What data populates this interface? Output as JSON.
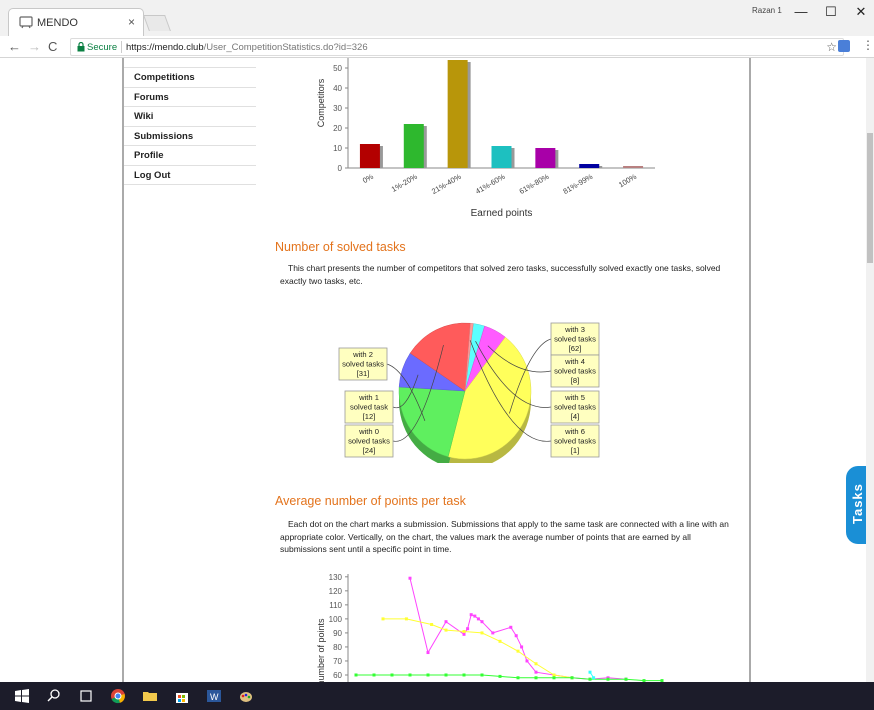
{
  "browser": {
    "tab_title": "MENDO",
    "tab_close": "×",
    "profile_name": "Razan 1",
    "minimize": "—",
    "maximize": "☐",
    "close": "✕",
    "secure_label": "Secure",
    "url_host": "https://mendo.club",
    "url_path": "/User_CompetitionStatistics.do?id=326"
  },
  "sidebar": {
    "items": [
      {
        "label": "Competitions"
      },
      {
        "label": "Forums"
      },
      {
        "label": "Wiki"
      },
      {
        "label": "Submissions"
      },
      {
        "label": "Profile"
      },
      {
        "label": "Log Out"
      }
    ]
  },
  "chart_data": [
    {
      "type": "bar",
      "xlabel": "Earned points",
      "ylabel": "Competitors",
      "categories": [
        "0%",
        "1%-20%",
        "21%-40%",
        "41%-60%",
        "61%-80%",
        "81%-99%",
        "100%"
      ],
      "values": [
        12,
        22,
        54,
        11,
        10,
        2,
        1
      ],
      "colors": [
        "#b30000",
        "#2eb82e",
        "#b8960a",
        "#1dc0c0",
        "#a800a8",
        "#0000a0",
        "#b88080"
      ],
      "yticks": [
        0,
        10,
        20,
        30,
        40,
        50
      ],
      "ylim": [
        0,
        55
      ]
    },
    {
      "type": "pie",
      "slices": [
        {
          "label_lines": [
            "with 0",
            "solved tasks",
            "[24]"
          ],
          "value": 24,
          "color": "#ff5b5b"
        },
        {
          "label_lines": [
            "with 1",
            "solved task",
            "[12]"
          ],
          "value": 12,
          "color": "#6b6bff"
        },
        {
          "label_lines": [
            "with 2",
            "solved tasks",
            "[31]"
          ],
          "value": 31,
          "color": "#5fef5f"
        },
        {
          "label_lines": [
            "with 3",
            "solved tasks",
            "[62]"
          ],
          "value": 62,
          "color": "#ffff5b"
        },
        {
          "label_lines": [
            "with 4",
            "solved tasks",
            "[8]"
          ],
          "value": 8,
          "color": "#ff5bff"
        },
        {
          "label_lines": [
            "with 5",
            "solved tasks",
            "[4]"
          ],
          "value": 4,
          "color": "#5bffff"
        },
        {
          "label_lines": [
            "with 6",
            "solved tasks",
            "[1]"
          ],
          "value": 1,
          "color": "#ff9b9b"
        }
      ]
    },
    {
      "type": "line",
      "ylabel": "number of points",
      "yticks": [
        60,
        70,
        80,
        90,
        100,
        110,
        120,
        130
      ],
      "ylim": [
        55,
        132
      ],
      "series": [
        {
          "color": "#ff44ff",
          "points": [
            [
              0.0,
              129
            ],
            [
              1.0,
              76
            ],
            [
              2.0,
              98
            ],
            [
              3.0,
              89
            ],
            [
              3.2,
              93
            ],
            [
              3.4,
              103
            ],
            [
              3.6,
              102
            ],
            [
              3.8,
              100
            ],
            [
              4.0,
              98
            ],
            [
              4.6,
              90
            ],
            [
              5.6,
              94
            ],
            [
              5.9,
              88
            ],
            [
              6.2,
              80
            ],
            [
              6.5,
              70
            ],
            [
              7.0,
              62
            ],
            [
              8.0,
              60
            ],
            [
              9.0,
              58
            ],
            [
              10.0,
              57
            ],
            [
              11.0,
              58
            ],
            [
              12.0,
              57
            ]
          ]
        },
        {
          "color": "#ffff33",
          "points": [
            [
              -1.5,
              100
            ],
            [
              -0.2,
              100
            ],
            [
              1.2,
              96
            ],
            [
              2.0,
              92
            ],
            [
              3.0,
              91
            ],
            [
              4.0,
              90
            ],
            [
              5.0,
              84
            ],
            [
              6.0,
              77
            ],
            [
              7.0,
              68
            ],
            [
              8.0,
              60
            ],
            [
              9.0,
              58
            ]
          ]
        },
        {
          "color": "#33ff33",
          "points": [
            [
              -3.0,
              60
            ],
            [
              -2.0,
              60
            ],
            [
              -1.0,
              60
            ],
            [
              0.0,
              60
            ],
            [
              1.0,
              60
            ],
            [
              2.0,
              60
            ],
            [
              3.0,
              60
            ],
            [
              4.0,
              60
            ],
            [
              5.0,
              59
            ],
            [
              6.0,
              58
            ],
            [
              7.0,
              58
            ],
            [
              8.0,
              58
            ],
            [
              9.0,
              58
            ],
            [
              10.0,
              57
            ],
            [
              11.0,
              57
            ],
            [
              12.0,
              57
            ],
            [
              13.0,
              56
            ],
            [
              14.0,
              56
            ]
          ]
        },
        {
          "color": "#33ffff",
          "points": [
            [
              10.0,
              62
            ],
            [
              10.2,
              58
            ]
          ]
        }
      ]
    }
  ],
  "sections": {
    "solved_title": "Number of solved tasks",
    "solved_desc": "This chart presents the number of competitors that solved zero tasks, successfully solved exactly one tasks, solved exactly two tasks, etc.",
    "avg_title": "Average number of points per task",
    "avg_desc": "Each dot on the chart marks a submission. Submissions that apply to the same task are connected with a line with an appropriate color. Vertically, on the chart, the values mark the average number of points that are earned by all submissions sent until a specific point in time."
  },
  "tasks_tab": "Tasks",
  "colors": {
    "accent": "#e3731c",
    "tasks_tab": "#1a8fd6",
    "secure": "#0b8043"
  }
}
